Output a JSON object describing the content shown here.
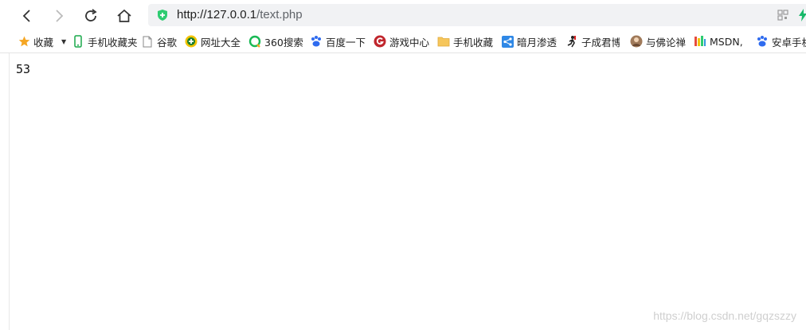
{
  "browser": {
    "url_host": "http://127.0.0.1",
    "url_path": "/text.php"
  },
  "bookmarks": [
    {
      "label": "收藏",
      "icon": "star-icon"
    },
    {
      "label": "手机收藏夹",
      "icon": "phone-icon"
    },
    {
      "label": "谷歌",
      "icon": "page-icon"
    },
    {
      "label": "网址大全",
      "icon": "plus-circle-icon"
    },
    {
      "label": "360搜索",
      "icon": "search-ring-icon"
    },
    {
      "label": "百度一下",
      "icon": "paw-icon"
    },
    {
      "label": "游戏中心",
      "icon": "game-icon"
    },
    {
      "label": "手机收藏",
      "icon": "folder-icon"
    },
    {
      "label": "暗月渗透",
      "icon": "share-icon"
    },
    {
      "label": "子成君博",
      "icon": "runner-icon"
    },
    {
      "label": "与佛论禅",
      "icon": "avatar-icon"
    },
    {
      "label": "MSDN,",
      "icon": "msdn-icon"
    },
    {
      "label": "安卓手机",
      "icon": "paw-icon"
    }
  ],
  "page": {
    "body_text": "53"
  },
  "watermark": "https://blog.csdn.net/gqzszzy",
  "colors": {
    "shield_green": "#2ecc71",
    "star_orange": "#f5a623",
    "baidu_blue": "#2f6bef"
  }
}
